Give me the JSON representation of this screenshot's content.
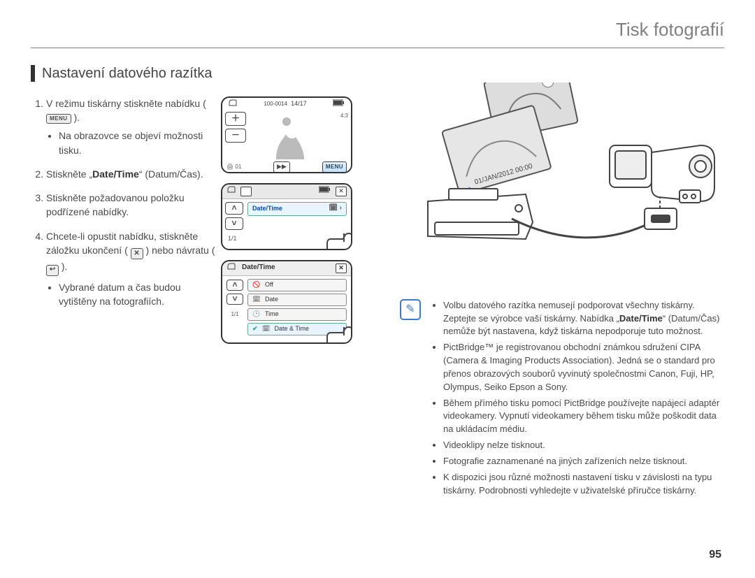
{
  "title": "Tisk fotografií",
  "section": "Nastavení datového razítka",
  "steps": {
    "s1a": "V režimu tiskárny stiskněte nabídku (",
    "s1b": ").",
    "s1_menu": "MENU",
    "s1_sub": "Na obrazovce se objeví možnosti tisku.",
    "s2a": "Stiskněte „",
    "s2b": "Date/Time",
    "s2c": "“ (Datum/Čas).",
    "s3": "Stiskněte požadovanou položku podřízené nabídky.",
    "s4a": "Chcete-li opustit nabídku, stiskněte záložku ukončení (",
    "s4b": ") nebo návratu (",
    "s4c": ").",
    "s4_sub": "Vybrané datum a čas budou vytištěny na fotografiích."
  },
  "screen1": {
    "counter": "14/17",
    "file": "100-0014",
    "copies": "01",
    "play": "▶▶",
    "menu": "MENU"
  },
  "screen2": {
    "row": "Date/Time",
    "page": "1/1"
  },
  "screen3": {
    "title": "Date/Time",
    "opt_off": "Off",
    "opt_date": "Date",
    "opt_time": "Time",
    "opt_dt": "Date & Time",
    "page": "1/1"
  },
  "photo_stamp": "01/JAN/2012 00:00",
  "notes": {
    "n1a": "Volbu datového razítka nemusejí podporovat všechny tiskárny. Zeptejte se výrobce vaší tiskárny. Nabídka „",
    "n1b": "Date/Time",
    "n1c": "“ (Datum/Čas) nemůže být nastavena, když tiskárna nepodporuje tuto možnost.",
    "n2": "PictBridge™ je registrovanou obchodní známkou sdružení CIPA (Camera & Imaging Products Association). Jedná se o standard pro přenos obrazových souborů vyvinutý společnostmi Canon, Fuji, HP, Olympus, Seiko Epson a Sony.",
    "n3": "Během přímého tisku pomocí PictBridge používejte napájecí adaptér videokamery. Vypnutí videokamery během tisku může poškodit data na ukládacím médiu.",
    "n4": "Videoklipy nelze tisknout.",
    "n5": "Fotografie zaznamenané na jiných zařízeních nelze tisknout.",
    "n6": "K dispozici jsou různé možnosti nastavení tisku v závislosti na typu tiskárny. Podrobnosti vyhledejte v uživatelské příručce tiskárny."
  },
  "page_number": "95"
}
